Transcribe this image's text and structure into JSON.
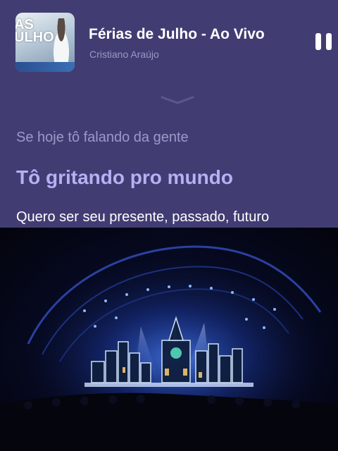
{
  "player": {
    "album_art_text": [
      "AS",
      "ULHO"
    ],
    "title": "Férias de Julho - Ao Vivo",
    "artist": "Cristiano Araújo"
  },
  "lyrics": {
    "previous": "Se hoje tô falando da gente",
    "current": "Tô gritando pro mundo",
    "next": "Quero ser seu presente, passado, futuro"
  },
  "colors": {
    "lyrics_background": "#413d73",
    "current_line": "#b6b0f4",
    "inactive_line": "#9d99c6",
    "stage_light": "#2f6cff"
  },
  "icons": {
    "playback_control": "pause-icon",
    "collapse": "chevron-down-icon"
  }
}
